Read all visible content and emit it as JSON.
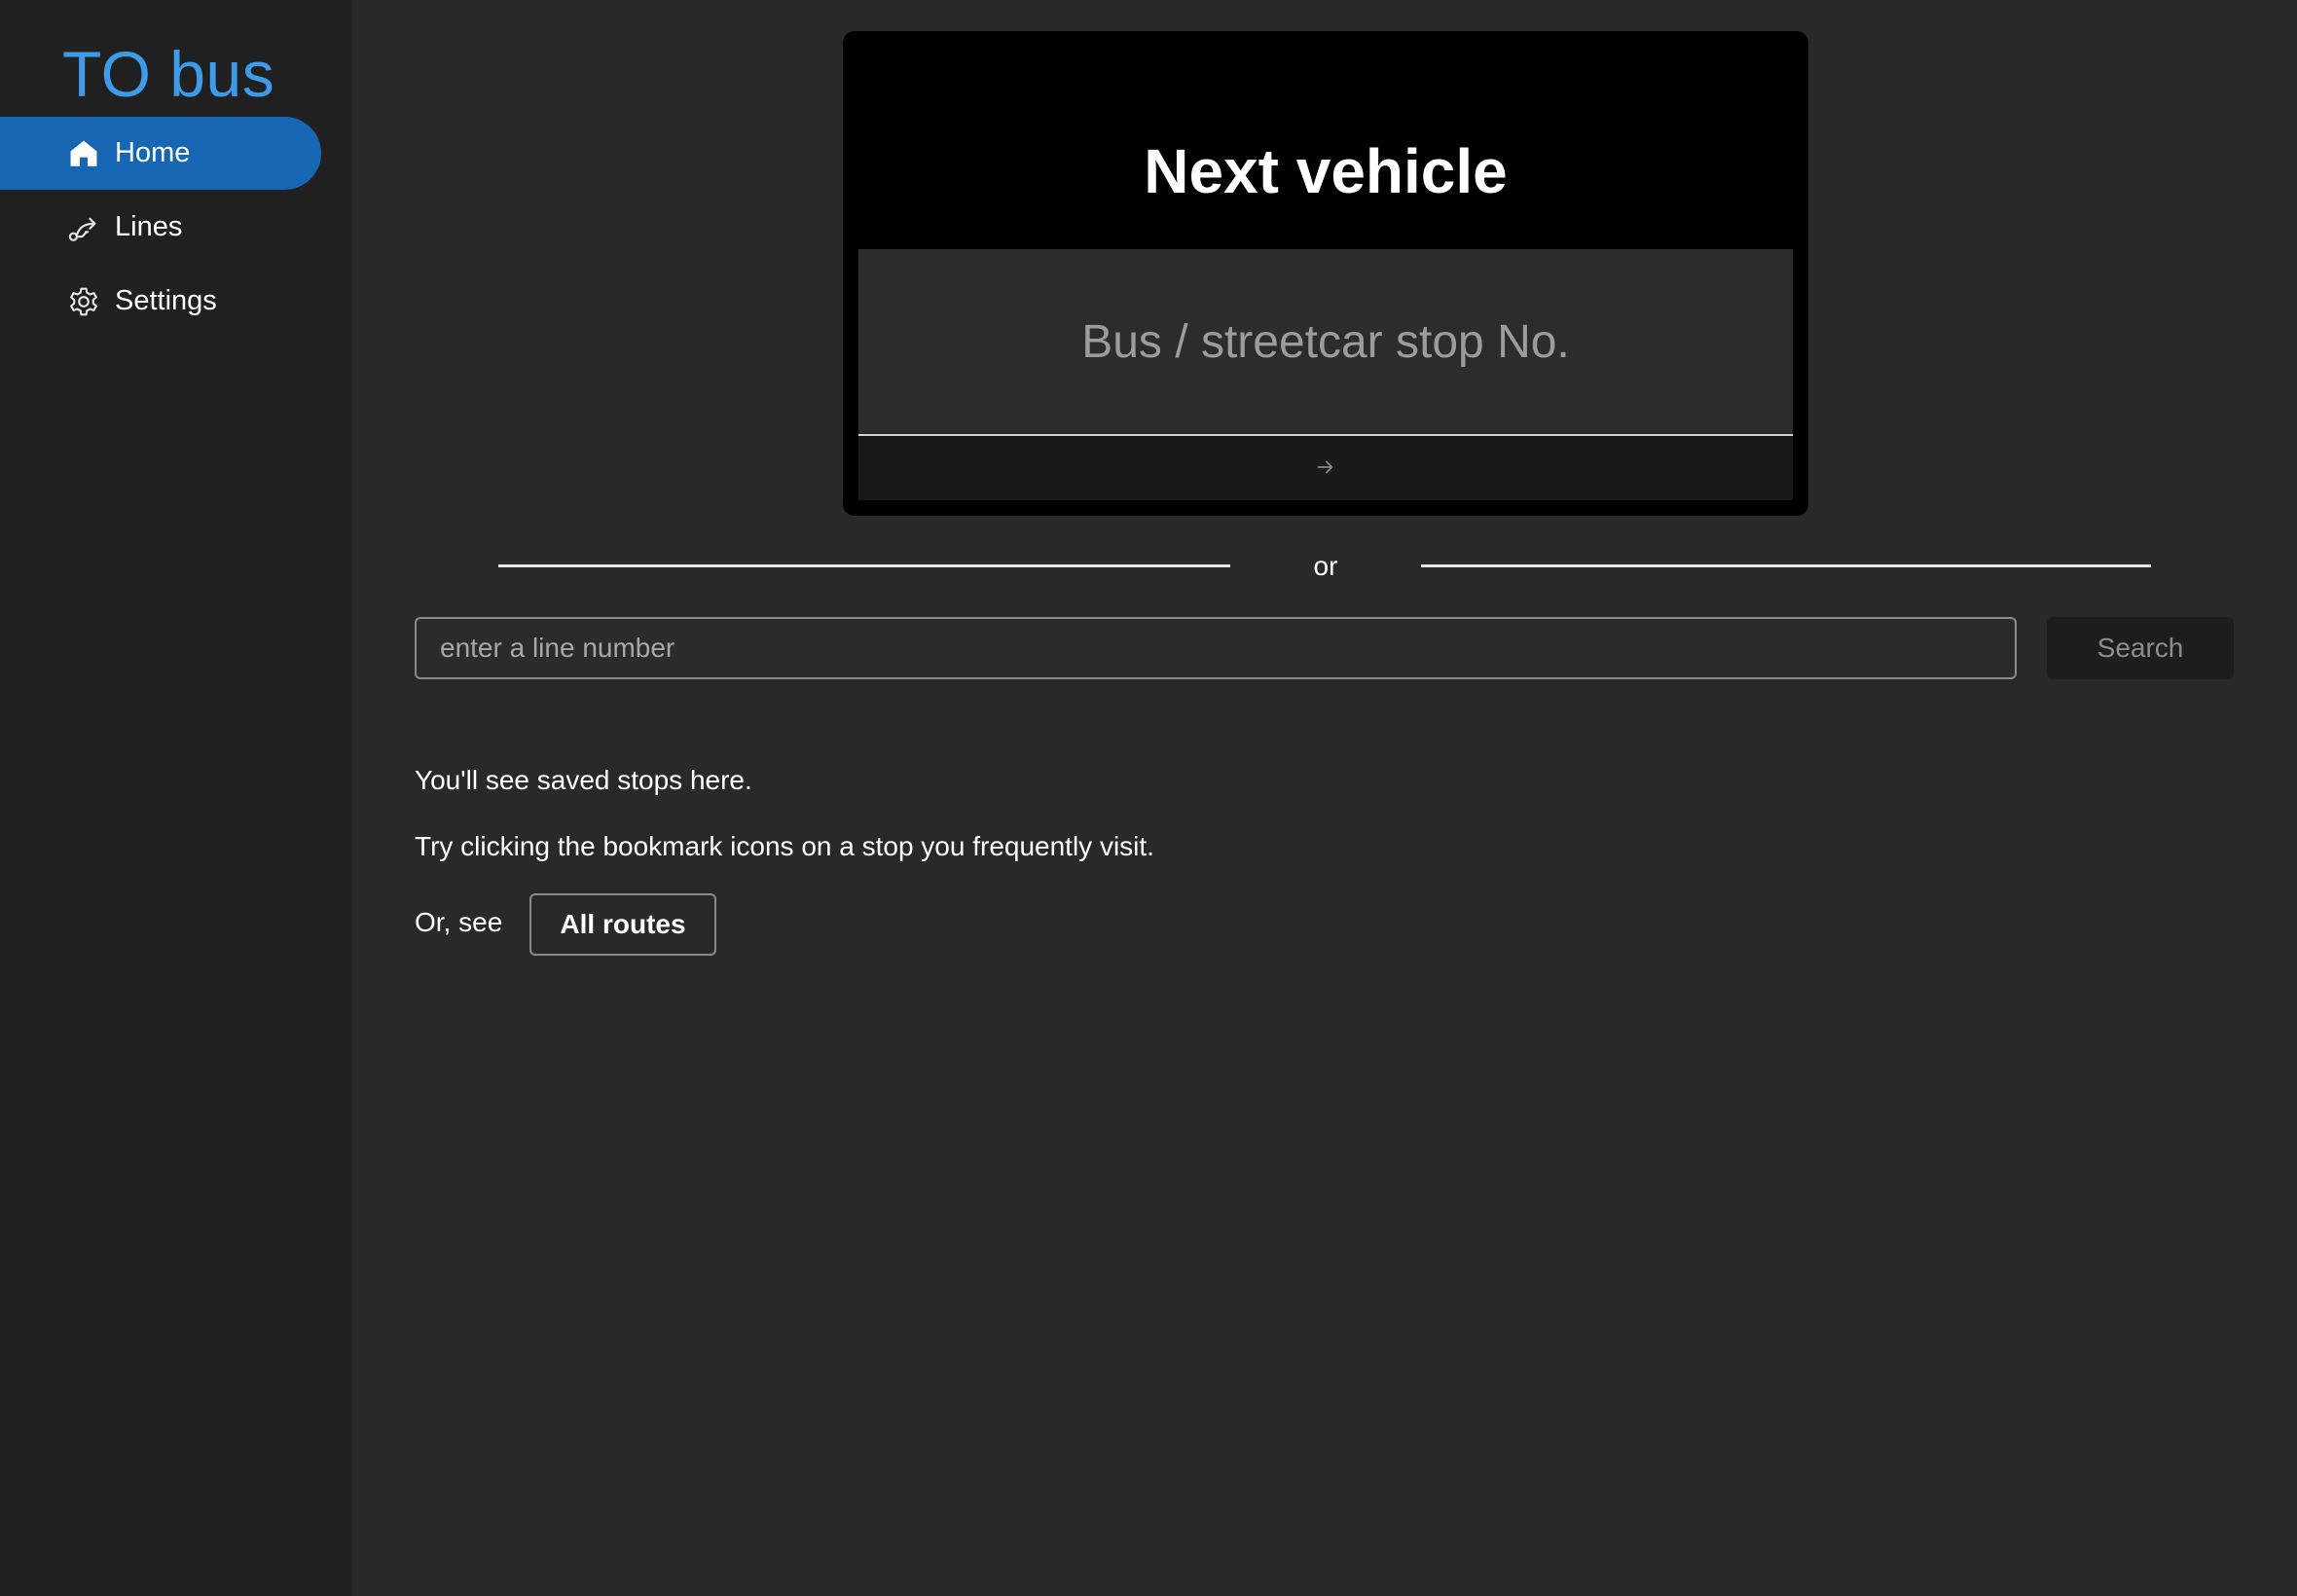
{
  "app": {
    "brand": "TO bus",
    "accent_color": "#3d9be9",
    "active_nav_color": "#1766b3"
  },
  "sidebar": {
    "items": [
      {
        "label": "Home",
        "icon": "home-icon",
        "active": true
      },
      {
        "label": "Lines",
        "icon": "route-icon",
        "active": false
      },
      {
        "label": "Settings",
        "icon": "gear-icon",
        "active": false
      }
    ]
  },
  "next_vehicle": {
    "title": "Next vehicle",
    "stop_placeholder": "Bus / streetcar stop No.",
    "stop_value": "",
    "submit_icon": "arrow-right-icon"
  },
  "divider": {
    "label": "or"
  },
  "line_search": {
    "placeholder": "enter a line number",
    "value": "",
    "button_label": "Search"
  },
  "saved_stops": {
    "empty_message": "You'll see saved stops here.",
    "hint": "Try clicking the bookmark icons on a stop you frequently visit.",
    "or_see_label": "Or, see",
    "all_routes_label": "All routes"
  }
}
